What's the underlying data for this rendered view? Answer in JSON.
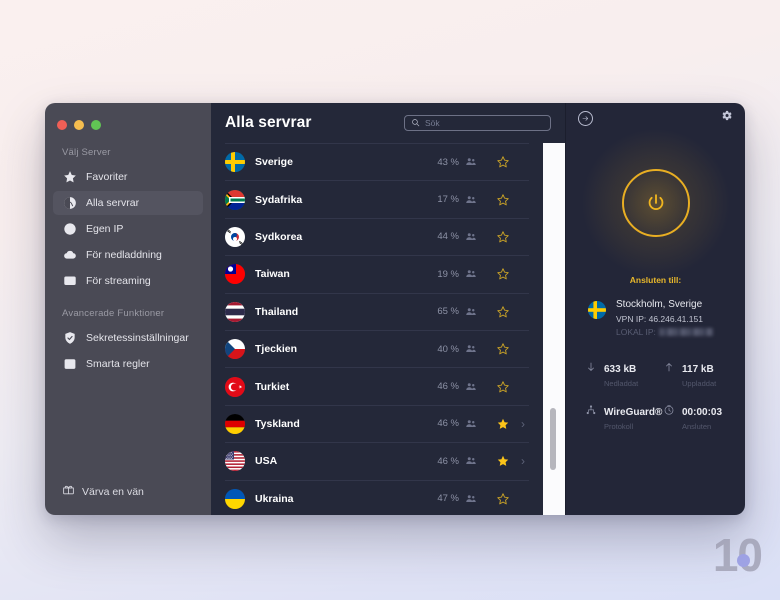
{
  "window": {
    "traffic_lights": [
      "close",
      "minimize",
      "maximize"
    ]
  },
  "sidebar": {
    "section1_label": "Välj Server",
    "section2_label": "Avancerade Funktioner",
    "items": [
      {
        "label": "Favoriter",
        "icon": "star-icon",
        "active": false
      },
      {
        "label": "Alla servrar",
        "icon": "globe-icon",
        "active": true
      },
      {
        "label": "Egen IP",
        "icon": "globe-grid-icon",
        "active": false
      },
      {
        "label": "För nedladdning",
        "icon": "cloud-download-icon",
        "active": false
      },
      {
        "label": "För streaming",
        "icon": "monitor-play-icon",
        "active": false
      }
    ],
    "advanced_items": [
      {
        "label": "Sekretessinställningar",
        "icon": "shield-check-icon",
        "active": false
      },
      {
        "label": "Smarta regler",
        "icon": "rules-list-icon",
        "active": false
      }
    ],
    "refer": {
      "label": "Värva en vän",
      "icon": "gift-icon"
    }
  },
  "list": {
    "title": "Alla servrar",
    "search_placeholder": "Sök",
    "search_value": "",
    "servers": [
      {
        "name": "Sverige",
        "load": "43 %",
        "favorite": false,
        "expandable": false,
        "flag": "se"
      },
      {
        "name": "Sydafrika",
        "load": "17 %",
        "favorite": false,
        "expandable": false,
        "flag": "za"
      },
      {
        "name": "Sydkorea",
        "load": "44 %",
        "favorite": false,
        "expandable": false,
        "flag": "kr"
      },
      {
        "name": "Taiwan",
        "load": "19 %",
        "favorite": false,
        "expandable": false,
        "flag": "tw"
      },
      {
        "name": "Thailand",
        "load": "65 %",
        "favorite": false,
        "expandable": false,
        "flag": "th"
      },
      {
        "name": "Tjeckien",
        "load": "40 %",
        "favorite": false,
        "expandable": false,
        "flag": "cz"
      },
      {
        "name": "Turkiet",
        "load": "46 %",
        "favorite": false,
        "expandable": false,
        "flag": "tr"
      },
      {
        "name": "Tyskland",
        "load": "46 %",
        "favorite": true,
        "expandable": true,
        "flag": "de"
      },
      {
        "name": "USA",
        "load": "46 %",
        "favorite": true,
        "expandable": true,
        "flag": "us"
      },
      {
        "name": "Ukraina",
        "load": "47 %",
        "favorite": false,
        "expandable": false,
        "flag": "ua"
      }
    ]
  },
  "panel": {
    "collapse_icon": "arrow-right-circle-icon",
    "settings_icon": "gear-icon",
    "power_state": "on",
    "connected_title": "Ansluten till:",
    "location": "Stockholm, Sverige",
    "vpn_ip": "VPN IP: 46.246.41.151",
    "local_ip_label": "LOKAL IP:",
    "local_ip_value": "",
    "stats": [
      {
        "icon": "arrow-down-icon",
        "value": "633 kB",
        "label": "Nedladdat"
      },
      {
        "icon": "arrow-up-icon",
        "value": "117 kB",
        "label": "Uppladdat"
      },
      {
        "icon": "network-icon",
        "value": "WireGuard®",
        "label": "Protokoll"
      },
      {
        "icon": "clock-icon",
        "value": "00:00:03",
        "label": "Ansluten"
      }
    ]
  },
  "watermark": {
    "text": "10"
  },
  "colors": {
    "accent": "#f0b51f",
    "favorite": "#fcc419",
    "sidebar_bg": "#4a4a55",
    "list_bg": "#242839",
    "panel_bg": "#232638"
  }
}
